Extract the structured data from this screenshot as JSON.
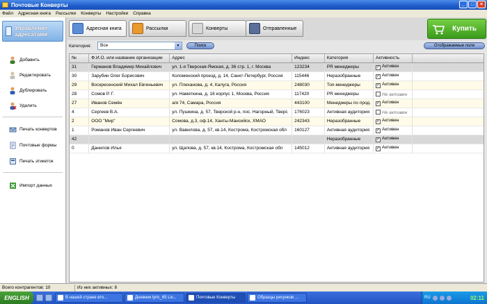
{
  "window": {
    "title": "Почтовые Конверты",
    "controls": [
      "_",
      "□",
      "×"
    ]
  },
  "menu": [
    "Файл",
    "Адресная книга",
    "Рассылки",
    "Конверты",
    "Настройки",
    "Справка"
  ],
  "sidebar": {
    "header": "Управление адресатами",
    "items": [
      {
        "label": "Добавить",
        "icon": "add-contact-icon"
      },
      {
        "label": "Редактировать",
        "icon": "edit-contact-icon"
      },
      {
        "label": "Дублировать",
        "icon": "duplicate-contact-icon"
      },
      {
        "label": "Удалить",
        "icon": "delete-contact-icon"
      },
      {
        "label": "Печать конвертов",
        "icon": "print-envelopes-icon"
      },
      {
        "label": "Почтовые формы",
        "icon": "postal-forms-icon"
      },
      {
        "label": "Печать этикеток",
        "icon": "print-labels-icon"
      },
      {
        "label": "Импорт данных",
        "icon": "import-data-icon"
      }
    ]
  },
  "tabs": [
    {
      "label": "Адресная книга",
      "active": true,
      "color": "#5c8ed8"
    },
    {
      "label": "Рассылки",
      "active": false,
      "color": "#e89a2c"
    },
    {
      "label": "Конверты",
      "active": false,
      "color": "#c9c9c9"
    },
    {
      "label": "Отправленные",
      "active": false,
      "color": "#5a6f9a"
    }
  ],
  "buy_button": {
    "label": "Купить"
  },
  "filter": {
    "category_label": "Категория:",
    "category_value": "Все",
    "search_button": "Поиск",
    "fields_button": "Отображаемые поля"
  },
  "table": {
    "columns": [
      "№",
      "Ф.И.О. или название организации",
      "Адрес",
      "Индекс",
      "Категория",
      "Активность"
    ],
    "rows": [
      {
        "num": "31",
        "name": "Германов Владимир Михайлович",
        "address": "ул. 1-я Тверская-Ямская, д. 36 стр. 1, г. Москва",
        "index": "123234",
        "category": "PR менеджеры",
        "active": true,
        "status": "Активен",
        "style": "sel"
      },
      {
        "num": "30",
        "name": "Зарубин Олег Борисович",
        "address": "Коломенский проезд, д. 14, Санкт-Петербург, Россия",
        "index": "115446",
        "category": "Неразобранные",
        "active": true,
        "status": "Активен",
        "style": ""
      },
      {
        "num": "29",
        "name": "Воскресенский Михал Евгеньевич",
        "address": "ул. Плеханова, д. 4, Калуга, Россия",
        "index": "248030",
        "category": "Топ-менеджеры",
        "active": true,
        "status": "Активен",
        "style": "alt"
      },
      {
        "num": "28",
        "name": "Сомов Р. Г.",
        "address": "ул. Наметкина, д. 16 корпус 1, Москва, Россия",
        "index": "117420",
        "category": "PR менеджеры",
        "active": false,
        "status": "Не активен",
        "style": ""
      },
      {
        "num": "27",
        "name": "Иванов Семён",
        "address": "а/я 74, Самара, Россия",
        "index": "443100",
        "category": "Менеджеры по прод.",
        "active": true,
        "status": "Активен",
        "style": "alt"
      },
      {
        "num": "4",
        "name": "Сергеев В.А.",
        "address": "ул. Пушкина, д. 57, Тверской р-н, пос. Нагорный, Тверс",
        "index": "176023",
        "category": "Активная аудитория",
        "active": false,
        "status": "Не активен",
        "style": ""
      },
      {
        "num": "2",
        "name": "ООО \"Мир\"",
        "address": "Сомова, д.3, оф.14, Ханты-Мансийск, ХМАО",
        "index": "242343",
        "category": "Неразобранные",
        "active": true,
        "status": "Активен",
        "style": "alt"
      },
      {
        "num": "1",
        "name": "Романов Иван Сергеевич",
        "address": "ул. Вавилова, д. 57, кв.14, Кострома, Костромская обл",
        "index": "160127",
        "category": "Активная аудитория",
        "active": true,
        "status": "Активен",
        "style": ""
      },
      {
        "num": "42",
        "name": "",
        "address": "",
        "index": "",
        "category": "Неразобранные",
        "active": true,
        "status": "Активен",
        "style": "sel"
      },
      {
        "num": "0",
        "name": "Данилов Илья",
        "address": "ул. Щапова, д. 57, кв.14, Кострома, Костромская обл",
        "index": "145012",
        "category": "Активная аудитория",
        "active": true,
        "status": "Активен",
        "style": ""
      }
    ]
  },
  "status": {
    "total": "Всего контрагентов: 10",
    "active": "Из них активных: 8"
  },
  "taskbar": {
    "start": "ENGLISH",
    "tasks": [
      {
        "label": "В нашей стране вто...",
        "active": false
      },
      {
        "label": "Дневник lyric_65 Liv...",
        "active": false
      },
      {
        "label": "Почтовые Конверты",
        "active": true
      },
      {
        "label": "Образцы рисунков ...",
        "active": false
      }
    ],
    "lang": "RU",
    "clock": "02:11"
  }
}
